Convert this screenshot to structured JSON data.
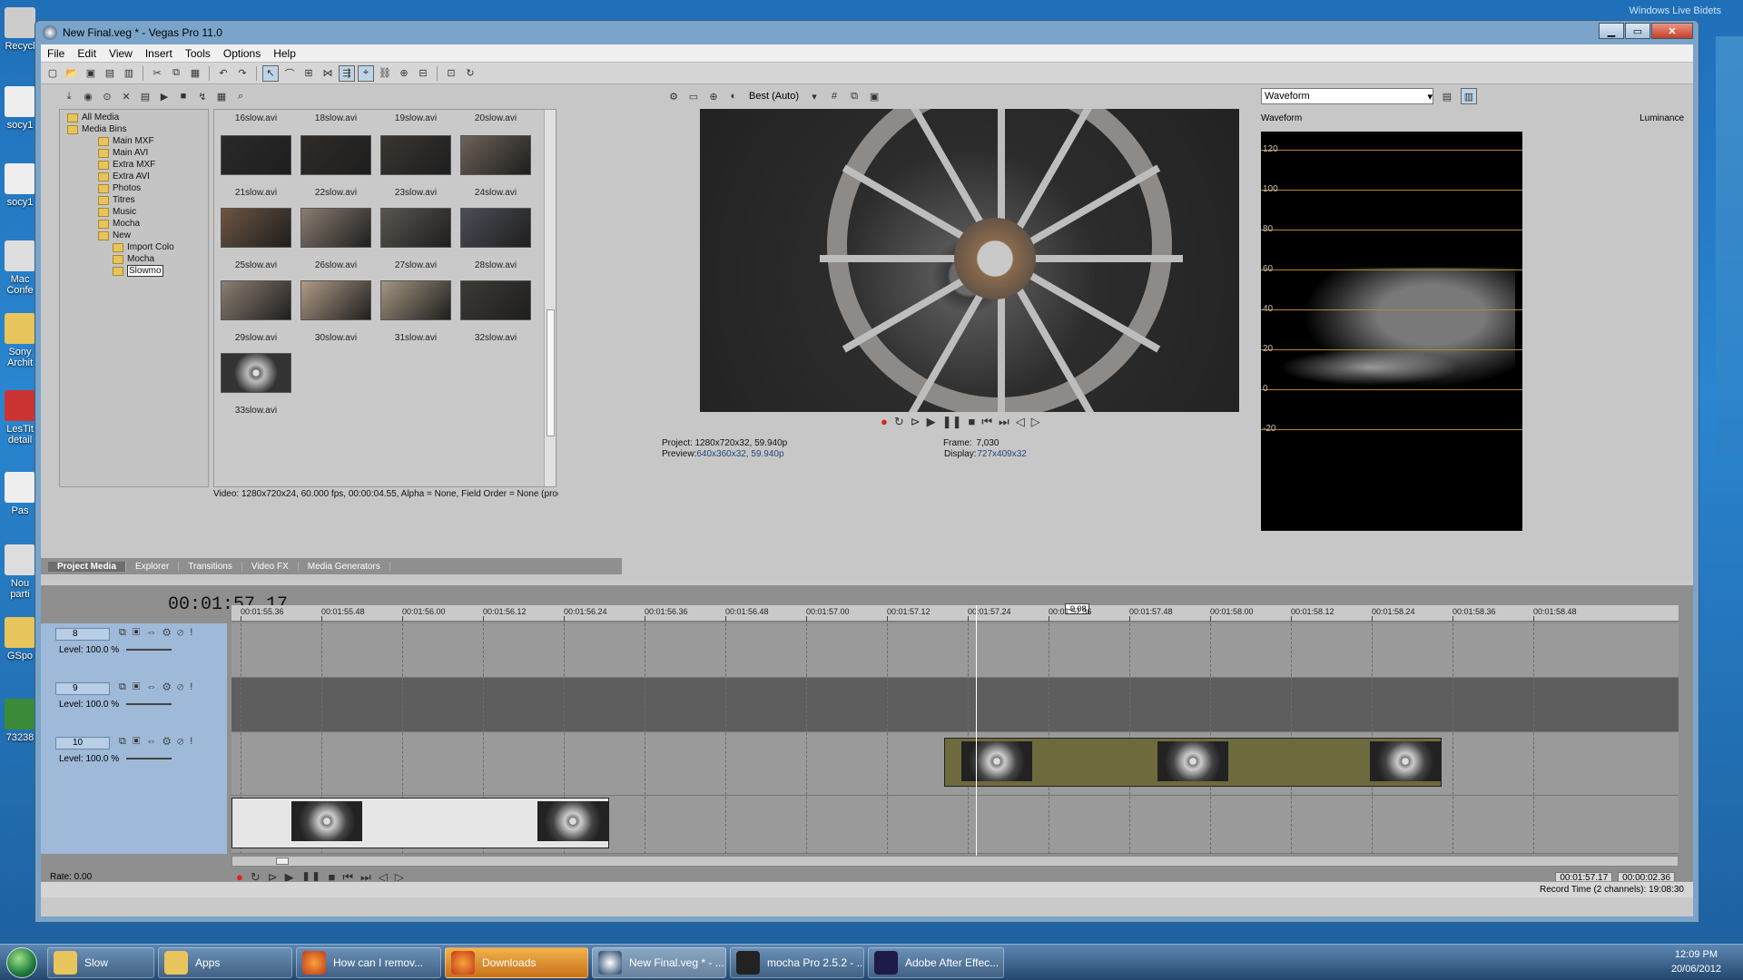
{
  "desktop": {
    "widget_caption": "Windows Live Bidets",
    "icons": [
      "Recycl",
      "socy1",
      "socy1",
      "Mac Confe",
      "Sony Archit",
      "LesTit detail",
      "Pas",
      "Nou parti",
      "GSpo",
      "73238"
    ]
  },
  "window": {
    "title": "New Final.veg * - Vegas Pro 11.0",
    "menu": [
      "File",
      "Edit",
      "View",
      "Insert",
      "Tools",
      "Options",
      "Help"
    ]
  },
  "media": {
    "tree": [
      {
        "label": "All Media",
        "level": 0
      },
      {
        "label": "Media Bins",
        "level": 0
      },
      {
        "label": "Main MXF",
        "level": 1
      },
      {
        "label": "Main AVI",
        "level": 1
      },
      {
        "label": "Extra MXF",
        "level": 1
      },
      {
        "label": "Extra AVI",
        "level": 1
      },
      {
        "label": "Photos",
        "level": 1
      },
      {
        "label": "Titres",
        "level": 1
      },
      {
        "label": "Music",
        "level": 1
      },
      {
        "label": "Mocha",
        "level": 1
      },
      {
        "label": "New",
        "level": 1
      },
      {
        "label": "Import Colo",
        "level": 2
      },
      {
        "label": "Mocha",
        "level": 2
      },
      {
        "label": "Slowmo",
        "level": 2,
        "selected": true
      }
    ],
    "thumbnails": [
      "16slow.avi",
      "18slow.avi",
      "19slow.avi",
      "20slow.avi",
      "21slow.avi",
      "22slow.avi",
      "23slow.avi",
      "24slow.avi",
      "25slow.avi",
      "26slow.avi",
      "27slow.avi",
      "28slow.avi",
      "29slow.avi",
      "30slow.avi",
      "31slow.avi",
      "32slow.avi",
      "33slow.avi"
    ],
    "info": "Video: 1280x720x24, 60.000 fps, 00:00:04.55, Alpha = None, Field Order = None (progressive :",
    "tabs": [
      "Project Media",
      "Explorer",
      "Transitions",
      "Video FX",
      "Media Generators"
    ]
  },
  "preview": {
    "quality": "Best (Auto)",
    "project_label": "Project:",
    "project_value": "1280x720x32, 59.940p",
    "preview_label": "Preview:",
    "preview_value": "640x360x32, 59.940p",
    "frame_label": "Frame:",
    "frame_value": "7,030",
    "display_label": "Display:",
    "display_value": "727x409x32"
  },
  "scope": {
    "mode": "Waveform",
    "title": "Waveform",
    "channel": "Luminance",
    "y_labels": [
      "120",
      "100",
      "80",
      "60",
      "40",
      "20",
      "0",
      "-20"
    ]
  },
  "timeline": {
    "timecode": "00:01:57.17",
    "zoom_indicator": "-0.08",
    "ruler": [
      "00:01:55.36",
      "00:01:55.48",
      "00:01:56.00",
      "00:01:56.12",
      "00:01:56.24",
      "00:01:56.36",
      "00:01:56.48",
      "00:01:57.00",
      "00:01:57.12",
      "00:01:57.24",
      "00:01:57.36",
      "00:01:57.48",
      "00:01:58.00",
      "00:01:58.12",
      "00:01:58.24",
      "00:01:58.36",
      "00:01:58.48"
    ],
    "tracks": [
      {
        "number": "8",
        "level": "Level: 100.0 %"
      },
      {
        "number": "9",
        "level": "Level: 100.0 %"
      },
      {
        "number": "10",
        "level": "Level: 100.0 %"
      }
    ],
    "rate": "Rate: 0.00",
    "cursor_time": "00:01:57.17",
    "length_time": "00:00:02.36",
    "record_time": "Record Time (2 channels): 19:08:30"
  },
  "taskbar": {
    "items": [
      {
        "label": "Slow",
        "icon": "folder-icon"
      },
      {
        "label": "Apps",
        "icon": "folder-icon"
      },
      {
        "label": "How can I remov...",
        "icon": "firefox-icon"
      },
      {
        "label": "Downloads",
        "icon": "firefox-icon",
        "state": "active"
      },
      {
        "label": "New Final.veg * - ...",
        "icon": "vegas-icon",
        "state": "current"
      },
      {
        "label": "mocha Pro 2.5.2 - ...",
        "icon": "mocha-icon"
      },
      {
        "label": "Adobe After Effec...",
        "icon": "after-effects-icon"
      }
    ],
    "time": "12:09 PM",
    "date": "20/06/2012"
  }
}
